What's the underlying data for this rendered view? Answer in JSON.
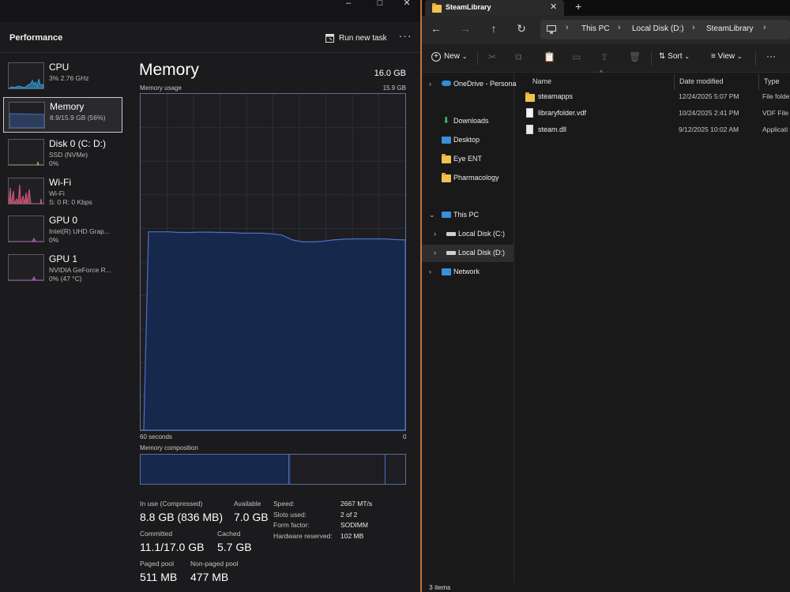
{
  "task_manager": {
    "header": {
      "title": "Performance",
      "run_new_task": "Run new task",
      "more": "···"
    },
    "sidebar": [
      {
        "name": "CPU",
        "sub1": "3% 2.76 GHz",
        "sub2": "",
        "icon": "cpu-graph-icon",
        "color": "#2f9fd8"
      },
      {
        "name": "Memory",
        "sub1": "8.9/15.9 GB (56%)",
        "sub2": "",
        "icon": "memory-graph-icon",
        "color": "#4a72c2",
        "selected": true
      },
      {
        "name": "Disk 0 (C: D:)",
        "sub1": "SSD (NVMe)",
        "sub2": "0%",
        "icon": "disk-graph-icon",
        "color": "#8fbf3a"
      },
      {
        "name": "Wi-Fi",
        "sub1": "Wi-Fi",
        "sub2": "S: 0 R: 0 Kbps",
        "icon": "wifi-graph-icon",
        "color": "#d9567a"
      },
      {
        "name": "GPU 0",
        "sub1": "Intel(R) UHD Grap...",
        "sub2": "0%",
        "icon": "gpu0-graph-icon",
        "color": "#b85bc4"
      },
      {
        "name": "GPU 1",
        "sub1": "NVIDIA GeForce R...",
        "sub2": "0% (47 °C)",
        "icon": "gpu1-graph-icon",
        "color": "#b85bc4"
      }
    ],
    "memory": {
      "heading": "Memory",
      "total": "16.0 GB",
      "usage_label": "Memory usage",
      "usage_max": "15.9 GB",
      "time_left": "60 seconds",
      "time_right": "0",
      "composition_label": "Memory composition",
      "composition": {
        "in_use_fraction": 0.56,
        "modified_fraction": 0.004,
        "standby_fraction": 0.36
      },
      "stats": {
        "in_use_label": "In use (Compressed)",
        "in_use_value": "8.8 GB (836 MB)",
        "available_label": "Available",
        "available_value": "7.0 GB",
        "committed_label": "Committed",
        "committed_value": "11.1/17.0 GB",
        "cached_label": "Cached",
        "cached_value": "5.7 GB",
        "paged_label": "Paged pool",
        "paged_value": "511 MB",
        "nonpaged_label": "Non-paged pool",
        "nonpaged_value": "477 MB"
      },
      "specs": [
        {
          "label": "Speed:",
          "value": "2667 MT/s"
        },
        {
          "label": "Slots used:",
          "value": "2 of 2"
        },
        {
          "label": "Form factor:",
          "value": "SODIMM"
        },
        {
          "label": "Hardware reserved:",
          "value": "102 MB"
        }
      ],
      "usage_history_fraction": [
        0.0,
        0.0,
        0.59,
        0.59,
        0.59,
        0.588,
        0.588,
        0.589,
        0.589,
        0.588,
        0.588,
        0.586,
        0.586,
        0.586,
        0.584,
        0.58,
        0.566,
        0.56,
        0.56,
        0.562,
        0.566,
        0.568,
        0.569,
        0.569,
        0.569,
        0.569,
        0.567,
        0.566
      ]
    },
    "colors": {
      "accent": "#4a72c2",
      "fill": "#17284d",
      "bg": "#1b1b1d"
    }
  },
  "explorer": {
    "tab_title": "SteamLibrary",
    "address": [
      "This PC",
      "Local Disk (D:)",
      "SteamLibrary"
    ],
    "toolbar": {
      "new": "New",
      "sort": "Sort",
      "view": "View",
      "more": "···"
    },
    "nav": [
      {
        "label": "OneDrive - Persona",
        "icon": "onedrive-icon",
        "chevron": "›",
        "indent": 0
      },
      {
        "label": "Downloads",
        "icon": "downloads-icon",
        "chevron": "",
        "indent": 0
      },
      {
        "label": "Desktop",
        "icon": "desktop-icon",
        "chevron": "",
        "indent": 0
      },
      {
        "label": "Eye ENT",
        "icon": "folder-icon",
        "chevron": "",
        "indent": 0
      },
      {
        "label": "Pharmacology",
        "icon": "folder-icon",
        "chevron": "",
        "indent": 0
      },
      {
        "label": "This PC",
        "icon": "pc-icon",
        "chevron": "⌄",
        "indent": 0
      },
      {
        "label": "Local Disk (C:)",
        "icon": "drive-icon",
        "chevron": "›",
        "indent": 1
      },
      {
        "label": "Local Disk (D:)",
        "icon": "drive-icon",
        "chevron": "›",
        "indent": 1,
        "selected": true
      },
      {
        "label": "Network",
        "icon": "network-icon",
        "chevron": "›",
        "indent": 0
      }
    ],
    "columns": {
      "name": "Name",
      "date": "Date modified",
      "type": "Type"
    },
    "files": [
      {
        "name": "steamapps",
        "date": "12/24/2025 5:07 PM",
        "type": "File folde",
        "icon": "folder-icon"
      },
      {
        "name": "libraryfolder.vdf",
        "date": "10/24/2025 2:41 PM",
        "type": "VDF File",
        "icon": "file-icon"
      },
      {
        "name": "steam.dll",
        "date": "9/12/2025 10:02 AM",
        "type": "Applicati",
        "icon": "dll-icon"
      }
    ],
    "status": "3 items"
  }
}
